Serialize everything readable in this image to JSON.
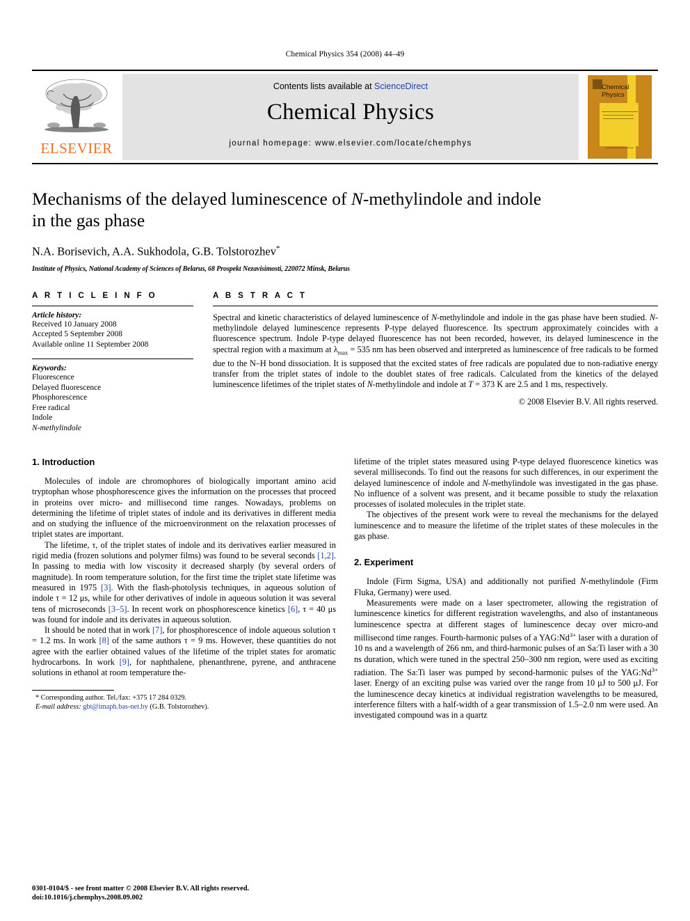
{
  "running_head": "Chemical Physics 354 (2008) 44–49",
  "banner": {
    "publisher_word": "ELSEVIER",
    "contents_prefix": "Contents lists available at ",
    "contents_link": "ScienceDirect",
    "journal_name": "Chemical Physics",
    "homepage": "journal homepage: www.elsevier.com/locate/chemphys",
    "cover_title_line1": "Chemical",
    "cover_title_line2": "Physics",
    "link_color": "#1f3fa8",
    "elsevier_orange": "#F27021",
    "cover_orange": "#C8861B",
    "cover_yellow": "#F4CF2A"
  },
  "article": {
    "title_line1_a": "Mechanisms of the delayed luminescence of ",
    "title_line1_italic": "N",
    "title_line1_b": "-methylindole and indole",
    "title_line2": "in the gas phase",
    "authors": "N.A. Borisevich, A.A. Sukhodola, G.B. Tolstorozhev",
    "author_star": "*",
    "affiliation": "Institute of Physics, National Academy of Sciences of Belarus, 68 Prospekt Nezavisimosti, 220072 Minsk, Belarus"
  },
  "info": {
    "heading": "A R T I C L E    I N F O",
    "history_label": "Article history:",
    "history": [
      "Received 10 January 2008",
      "Accepted 5 September 2008",
      "Available online 11 September 2008"
    ],
    "keywords_label": "Keywords:",
    "keywords": [
      "Fluorescence",
      "Delayed fluorescence",
      "Phosphorescence",
      "Free radical",
      "Indole",
      "N-methylindole"
    ]
  },
  "abstract": {
    "heading": "A B S T R A C T",
    "body": "Spectral and kinetic characteristics of delayed luminescence of N-methylindole and indole in the gas phase have been studied. N-methylindole delayed luminescence represents P-type delayed fluorescence. Its spectrum approximately coincides with a fluorescence spectrum. Indole P-type delayed fluorescence has not been recorded, however, its delayed luminescence in the spectral region with a maximum at λmax = 535 nm has been observed and interpreted as luminescence of free radicals to be formed due to the N–H bond dissociation. It is supposed that the excited states of free radicals are populated due to non-radiative energy transfer from the triplet states of indole to the doublet states of free radicals. Calculated from the kinetics of the delayed luminescence lifetimes of the triplet states of N-methylindole and indole at T = 373 K are 2.5 and 1 ms, respectively.",
    "copyright": "© 2008 Elsevier B.V. All rights reserved."
  },
  "sections": {
    "introduction_heading": "1. Introduction",
    "experiment_heading": "2. Experiment",
    "intro_p1": "Molecules of indole are chromophores of biologically important amino acid tryptophan whose phosphorescence gives the information on the processes that proceed in proteins over micro- and millisecond time ranges. Nowadays, problems on determining the lifetime of triplet states of indole and its derivatives in different media and on studying the influence of the microenvironment on the relaxation processes of triplet states are important.",
    "intro_p2": "The lifetime, τ, of the triplet states of indole and its derivatives earlier measured in rigid media (frozen solutions and polymer films) was found to be several seconds [1,2]. In passing to media with low viscosity it decreased sharply (by several orders of magnitude). In room temperature solution, for the first time the triplet state lifetime was measured in 1975 [3]. With the flash-photolysis techniques, in aqueous solution of indole τ = 12 μs, while for other derivatives of indole in aqueous solution it was several tens of microseconds [3–5]. In recent work on phosphorescence kinetics [6], τ = 40 μs was found for indole and its derivates in aqueous solution.",
    "intro_p3": "It should be noted that in work [7], for phosphorescence of indole aqueous solution τ = 1.2 ms. In work [8] of the same authors τ = 9 ms. However, these quantities do not agree with the earlier obtained values of the lifetime of the triplet states for aromatic hydrocarbons. In work [9], for naphthalene, phenanthrene, pyrene, and anthracene solutions in ethanol at room temperature the lifetime of the triplet states measured using P-type delayed fluorescence kinetics was several milliseconds. To find out the reasons for such differences, in our experiment the delayed luminescence of indole and N-methylindole was investigated in the gas phase. No influence of a solvent was present, and it became possible to study the relaxation processes of isolated molecules in the triplet state.",
    "intro_p4": "The objectives of the present work were to reveal the mechanisms for the delayed luminescence and to measure the lifetime of the triplet states of these molecules in the gas phase.",
    "exp_p1": "Indole (Firm Sigma, USA) and additionally not purified N-methylindole (Firm Fluka, Germany) were used.",
    "exp_p2": "Measurements were made on a laser spectrometer, allowing the registration of luminescence kinetics for different registration wavelengths, and also of instantaneous luminescence spectra at different stages of luminescence decay over micro-and millisecond time ranges. Fourth-harmonic pulses of a YAG:Nd3+ laser with a duration of 10 ns and a wavelength of 266 nm, and third-harmonic pulses of an Sa:Ti laser with a 30 ns duration, which were tuned in the spectral 250–300 nm region, were used as exciting radiation. The Sa:Ti laser was pumped by second-harmonic pulses of the YAG:Nd3+ laser. Energy of an exciting pulse was varied over the range from 10 μJ to 500 μJ. For the luminescence decay kinetics at individual registration wavelengths to be measured, interference filters with a half-width of a gear transmission of 1.5–2.0 nm were used. An investigated compound was in a quartz"
  },
  "footnote": {
    "marker": "*",
    "corresponding": "Corresponding author. Tel./fax: +375 17 284 0329.",
    "email_label": "E-mail address:",
    "email": "gbt@imaph.bas-net.by",
    "email_owner": "(G.B. Tolstorozhev)."
  },
  "footer": {
    "line1": "0301-0104/$ - see front matter © 2008 Elsevier B.V. All rights reserved.",
    "line2": "doi:10.1016/j.chemphys.2008.09.002"
  }
}
